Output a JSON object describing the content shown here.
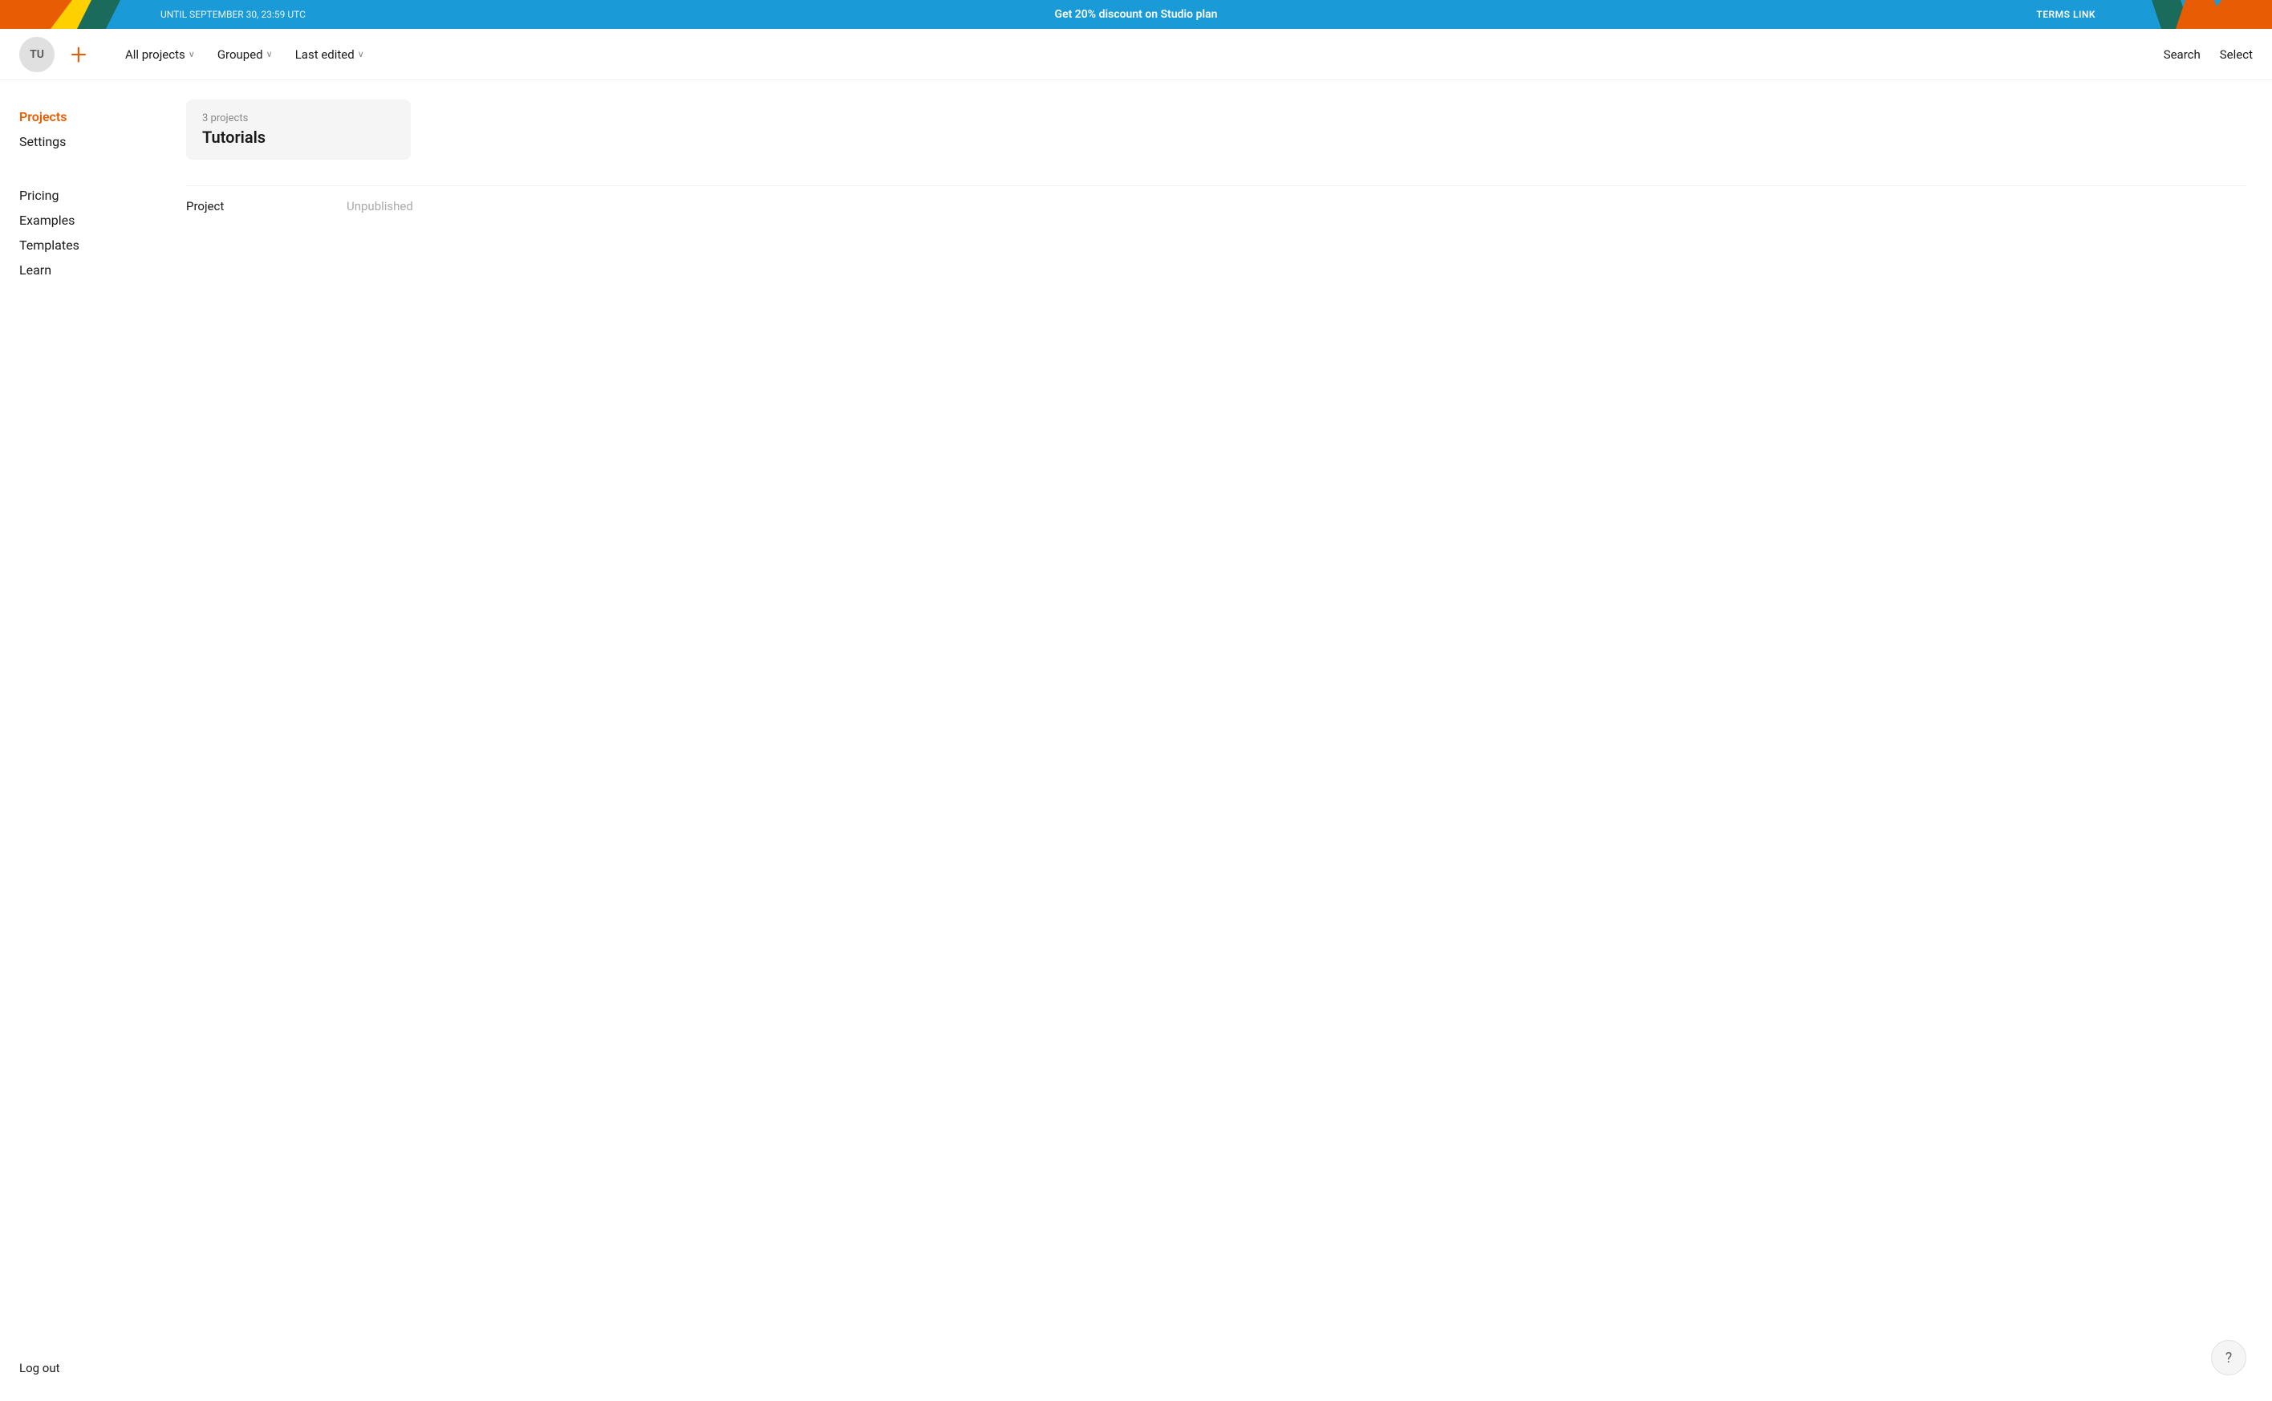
{
  "banner": {
    "until_text": "UNTIL SEPTEMBER 30, 23:59 UTC",
    "promo_text": "Get 20% discount on Studio plan",
    "terms_text": "TERMS LINK"
  },
  "header": {
    "avatar_initials": "TU",
    "new_project_label": "+",
    "nav_items": [
      {
        "label": "All projects",
        "has_chevron": true
      },
      {
        "label": "Grouped",
        "has_chevron": true
      },
      {
        "label": "Last edited",
        "has_chevron": true
      }
    ],
    "search_label": "Search",
    "select_label": "Select"
  },
  "sidebar": {
    "items": [
      {
        "label": "Projects",
        "active": true
      },
      {
        "label": "Settings",
        "active": false
      }
    ],
    "links": [
      {
        "label": "Pricing"
      },
      {
        "label": "Examples"
      },
      {
        "label": "Templates"
      },
      {
        "label": "Learn"
      }
    ],
    "logout_label": "Log out"
  },
  "main": {
    "group": {
      "count_text": "3 projects",
      "title": "Tutorials"
    },
    "project_row": {
      "name": "Project",
      "status": "Unpublished"
    }
  },
  "help": {
    "label": "?"
  }
}
